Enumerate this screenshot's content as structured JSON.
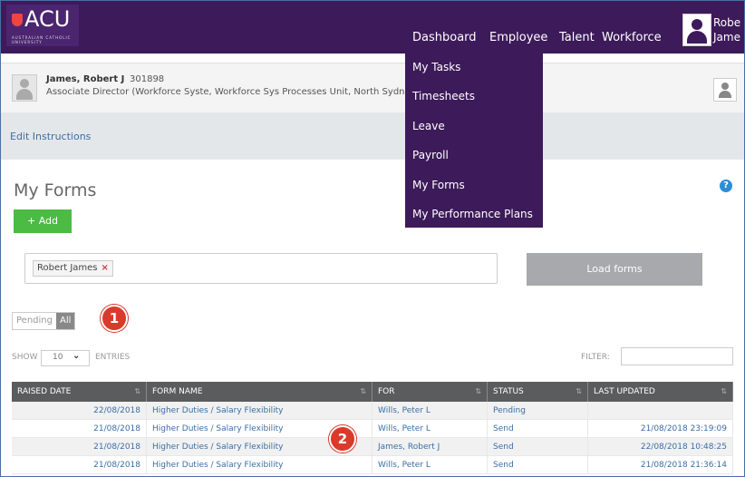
{
  "brand": {
    "logo_text": "ACU",
    "logo_subtitle": "AUSTRALIAN CATHOLIC UNIVERSITY"
  },
  "topnav": {
    "items": [
      "Dashboard",
      "Employee",
      "Talent",
      "Workforce"
    ],
    "user_name": "Robe\nJame"
  },
  "dropdown": {
    "items": [
      "My Tasks",
      "Timesheets",
      "Leave",
      "Payroll",
      "My Forms",
      "My Performance Plans"
    ]
  },
  "profile": {
    "name": "James, Robert J",
    "id": "301898",
    "role": "Associate Director (Workforce Syste, Workforce Sys Processes Unit, North Sydne"
  },
  "instructions_link": "Edit Instructions",
  "page": {
    "title": "My Forms",
    "help_icon": "?",
    "add_label": "+ Add"
  },
  "search": {
    "chip": "Robert James",
    "chip_remove": "×"
  },
  "load_label": "Load forms",
  "toggle": {
    "pending": "Pending",
    "all": "All"
  },
  "badges": [
    "1",
    "2"
  ],
  "table_controls": {
    "show": "SHOW",
    "entries_value": "10",
    "entries": "ENTRIES",
    "filter": "FILTER:"
  },
  "table": {
    "headers": [
      "RAISED DATE",
      "FORM NAME",
      "FOR",
      "STATUS",
      "LAST UPDATED"
    ],
    "rows": [
      [
        "22/08/2018",
        "Higher Duties / Salary Flexibility",
        "Wills, Peter L",
        "Pending",
        ""
      ],
      [
        "21/08/2018",
        "Higher Duties / Salary Flexibility",
        "Wills, Peter L",
        "Send",
        "21/08/2018 23:19:09"
      ],
      [
        "21/08/2018",
        "Higher Duties / Salary Flexibility",
        "James, Robert J",
        "Send",
        "22/08/2018 10:48:25"
      ],
      [
        "21/08/2018",
        "Higher Duties / Salary Flexibility",
        "Wills, Peter L",
        "Send",
        "21/08/2018 21:36:14"
      ]
    ]
  },
  "colors": {
    "brand_purple": "#3d1a5a",
    "add_green": "#4cbb44",
    "badge_red": "#d93b2b",
    "link_blue": "#3a6ea5"
  }
}
